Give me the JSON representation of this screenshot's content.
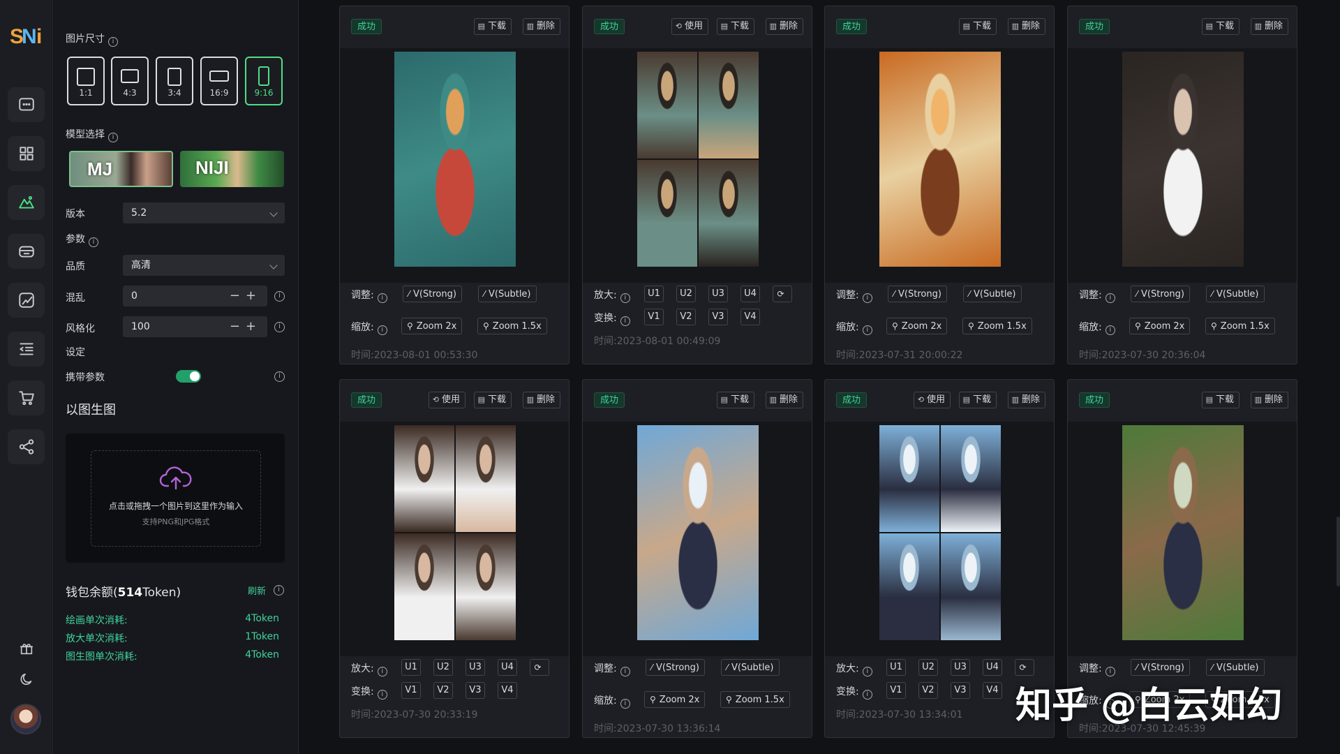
{
  "rail": {
    "logo_text": "SNi",
    "icons": [
      "chat-icon",
      "grid-icon",
      "mountain-image-icon",
      "wallet-icon",
      "edit-image-icon",
      "list-indent-icon",
      "cart-icon",
      "share-icon"
    ],
    "bottom_icons": [
      "gift-icon",
      "moon-icon"
    ]
  },
  "panel": {
    "size_label": "图片尺寸",
    "ratios": [
      {
        "label": "1:1",
        "active": false
      },
      {
        "label": "4:3",
        "active": false
      },
      {
        "label": "3:4",
        "active": false
      },
      {
        "label": "16:9",
        "active": false
      },
      {
        "label": "9:16",
        "active": true
      }
    ],
    "model_label": "模型选择",
    "models": [
      {
        "label": "MJ",
        "selected": true
      },
      {
        "label": "NIJI",
        "selected": false
      }
    ],
    "version_label": "版本",
    "version_value": "5.2",
    "params_label": "参数",
    "quality_label": "品质",
    "quality_value": "高清",
    "chaos_label": "混乱",
    "chaos_value": "0",
    "stylize_label": "风格化",
    "stylize_value": "100",
    "stepper_symbols": "−+",
    "settings_label": "设定",
    "carry_params_label": "携带参数",
    "carry_params_on": true,
    "img2img_title": "以图生图",
    "upload_hint": "点击或拖拽一个图片到这里作为输入",
    "upload_formats": "支持PNG和JPG格式",
    "wallet_prefix": "钱包余额(",
    "wallet_amount": "514",
    "wallet_suffix": "Token)",
    "refresh_label": "刷新",
    "costs": [
      {
        "label": "绘画单次消耗:",
        "value": "4Token"
      },
      {
        "label": "放大单次消耗:",
        "value": "1Token"
      },
      {
        "label": "图生图单次消耗:",
        "value": "4Token"
      }
    ]
  },
  "gallery": {
    "status_text": "成功",
    "use_label": "使用",
    "download_label": "下载",
    "delete_label": "删除",
    "adjust_label": "调整:",
    "zoom_label": "缩放:",
    "upscale_label": "放大:",
    "variation_label": "变换:",
    "v_strong": "V(Strong)",
    "v_subtle": "V(Subtle)",
    "zoom_2x": "Zoom 2x",
    "zoom_15x": "Zoom 1.5x",
    "u_buttons": [
      "U1",
      "U2",
      "U3",
      "U4"
    ],
    "v_buttons": [
      "V1",
      "V2",
      "V3",
      "V4"
    ],
    "time_prefix": "时间:",
    "cards": [
      {
        "type": "single",
        "has_use": false,
        "time": "2023-08-01 00:53:30"
      },
      {
        "type": "grid",
        "has_use": true,
        "time": "2023-08-01 00:49:09"
      },
      {
        "type": "single",
        "has_use": false,
        "time": "2023-07-31 20:00:22"
      },
      {
        "type": "single",
        "has_use": false,
        "time": "2023-07-30 20:36:04"
      },
      {
        "type": "grid",
        "has_use": true,
        "time": "2023-07-30 20:33:19"
      },
      {
        "type": "single",
        "has_use": false,
        "time": "2023-07-30 13:36:14"
      },
      {
        "type": "grid",
        "has_use": true,
        "time": "2023-07-30 13:34:01"
      },
      {
        "type": "single",
        "has_use": false,
        "time": "2023-07-30 12:45:39"
      }
    ]
  },
  "watermark": "知乎 @白云如幻",
  "colors": {
    "accent_green": "#3fd39b",
    "ratio_active": "#4fdf86",
    "upload_icon": "#b363d9"
  }
}
